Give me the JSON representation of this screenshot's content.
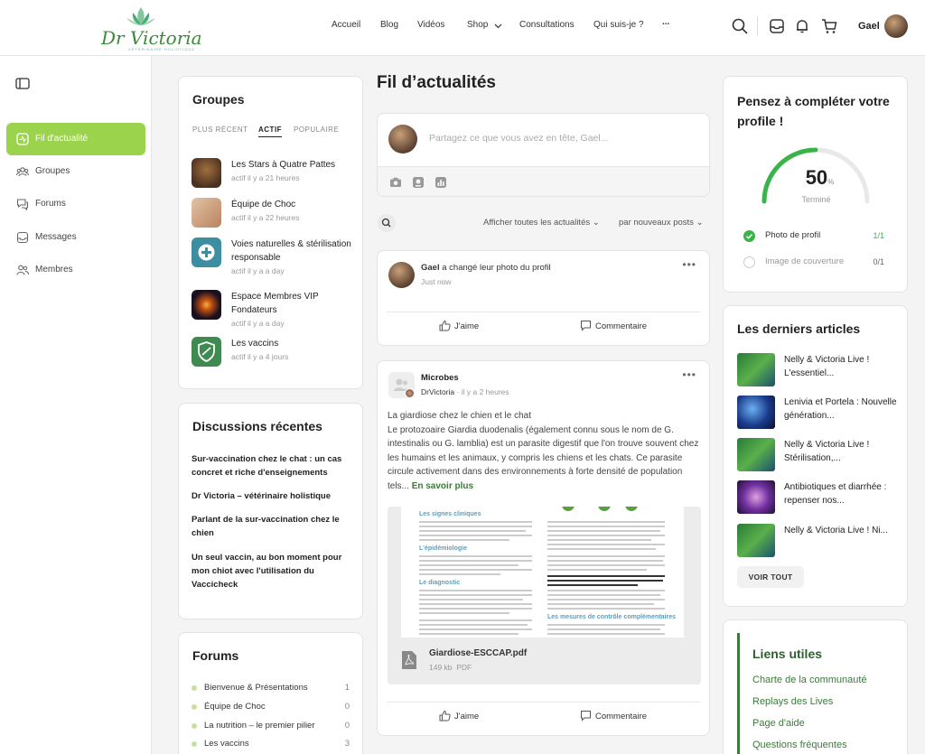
{
  "brand": {
    "logo_text": "Dr Victoria",
    "logo_sub": "VÉTÉRINAIRE HOLISTIQUE"
  },
  "nav": {
    "items": [
      "Accueil",
      "Blog",
      "Vidéos",
      "Shop",
      "Consultations",
      "Qui suis-je ?",
      "..."
    ]
  },
  "user": {
    "name": "Gael"
  },
  "sidebar": {
    "items": [
      {
        "label": "Fil d'actualité",
        "icon": "activity-icon",
        "active": true
      },
      {
        "label": "Groupes",
        "icon": "groups-icon"
      },
      {
        "label": "Forums",
        "icon": "forums-icon"
      },
      {
        "label": "Messages",
        "icon": "messages-icon"
      },
      {
        "label": "Membres",
        "icon": "members-icon"
      }
    ]
  },
  "groups_widget": {
    "title": "Groupes",
    "tabs": [
      "PLUS RÉCENT",
      "ACTIF",
      "POPULAIRE"
    ],
    "active_tab": "ACTIF",
    "items": [
      {
        "name": "Les Stars à Quatre Pattes",
        "meta": "actif il y a 21 heures"
      },
      {
        "name": "Équipe de Choc",
        "meta": "actif il y a 22 heures"
      },
      {
        "name": "Voies naturelles & stérilisation responsable",
        "meta": "actif il y a a day"
      },
      {
        "name": "Espace Membres VIP Fondateurs",
        "meta": "actif il y a a day"
      },
      {
        "name": "Les vaccins",
        "meta": "actif il y a 4 jours"
      }
    ]
  },
  "discussions_widget": {
    "title": "Discussions récentes",
    "items": [
      "Sur-vaccination chez le chat : un cas concret et riche d'enseignements",
      "Dr Victoria – vétérinaire holistique",
      "Parlant de la sur-vaccination chez le chien",
      "Un seul vaccin, au bon moment pour mon chiot avec l'utilisation du Vaccicheck"
    ]
  },
  "forums_widget": {
    "title": "Forums",
    "items": [
      {
        "name": "Bienvenue & Présentations",
        "count": "1"
      },
      {
        "name": "Équipe de Choc",
        "count": "0"
      },
      {
        "name": "La nutrition – le premier pilier",
        "count": "0"
      },
      {
        "name": "Les vaccins",
        "count": "3"
      }
    ]
  },
  "feed": {
    "title": "Fil d’actualités",
    "composer_placeholder": "Partagez ce que vous avez en tête, Gael...",
    "filter_show": "Afficher toutes les actualités",
    "filter_sort": "par nouveaux posts",
    "posts": [
      {
        "author": "Gael",
        "action": "a changé leur photo du profil",
        "time": "Just now",
        "like_label": "J'aime",
        "comment_label": "Commentaire"
      },
      {
        "group": "Microbes",
        "author": "DrVictoria",
        "time": "· il y a 2 heures",
        "title_line": "La giardiose chez le chien et le chat",
        "body": "Le protozoaire Giardia duodenalis (également connu sous le nom de G. intestinalis ou G. lamblia) est un parasite digestif que l'on trouve souvent chez les humains et les animaux, y compris les chiens et les chats. Ce parasite circule activement dans des environnements à forte densité de population tels...",
        "read_more": "En savoir plus",
        "doc_headings": [
          "Les signes cliniques",
          "L'épidémiologie",
          "Le diagnostic",
          "Les mesures de contrôle complémentaires"
        ],
        "attachment_name": "Giardiose-ESCCAP.pdf",
        "attachment_meta": "149 kb  PDF",
        "like_label": "J'aime",
        "comment_label": "Commentaire"
      }
    ]
  },
  "profile_widget": {
    "title": "Pensez à compléter votre profile !",
    "progress_value": "50",
    "progress_unit": "%",
    "progress_fraction": 0.5,
    "progress_label": "Terminé",
    "steps": [
      {
        "label": "Photo de profil",
        "count": "1/1",
        "done": true
      },
      {
        "label": "Image de couverture",
        "count": "0/1",
        "done": false
      }
    ]
  },
  "articles_widget": {
    "title": "Les derniers articles",
    "items": [
      "Nelly & Victoria Live ! L'essentiel...",
      "Lenivia et Portela : Nouvelle génération...",
      "Nelly & Victoria Live ! Stérilisation,...",
      "Antibiotiques et diarrhée : repenser nos...",
      "Nelly & Victoria Live ! Ni..."
    ],
    "button": "VOIR TOUT"
  },
  "links_widget": {
    "title": "Liens utiles",
    "items": [
      "Charte de la communauté",
      "Replays des Lives",
      "Page d'aide",
      "Questions fréquentes"
    ]
  },
  "colors": {
    "accent": "#9bd34d",
    "link": "#3a7a3a",
    "progress": "#3cb34a"
  }
}
